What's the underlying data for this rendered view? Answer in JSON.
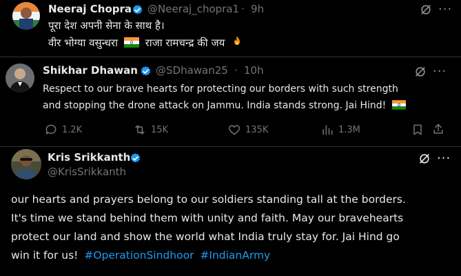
{
  "tweets": [
    {
      "name": "Neeraj Chopra",
      "handle": "@Neeraj_chopra1",
      "time": "9h",
      "lines": [
        "पूरा देश अपनी सेना के साथ है।",
        "वीर भोग्या वसुन्धरा",
        "राजा रामचन्द्र की जय"
      ]
    },
    {
      "name": "Shikhar Dhawan",
      "handle": "@SDhawan25",
      "time": "10h",
      "lines": [
        "Respect to our brave hearts for protecting our borders with such strength",
        "and stopping the drone attack on Jammu. India stands strong. Jai Hind!"
      ],
      "replies": "1.2K",
      "reposts": "15K",
      "likes": "135K",
      "views": "1.3M"
    },
    {
      "name": "Kris Srikkanth",
      "handle": "@KrisSrikkanth",
      "lines": [
        "our hearts and prayers belong to our soldiers standing tall at the borders.",
        "It's time we stand behind them with unity and faith. May our bravehearts",
        "protect our land and show the world what India truly stay for. Jai Hind go",
        "win it for us!"
      ],
      "hashtags": [
        "#OperationSindhoor",
        "#IndianArmy"
      ]
    }
  ],
  "dot": "·",
  "more": "···",
  "colors": {
    "background": "#000000",
    "text": "#e7e9ea",
    "muted": "#71767b",
    "accent": "#1d9bf0",
    "separator": "#2f3336"
  }
}
